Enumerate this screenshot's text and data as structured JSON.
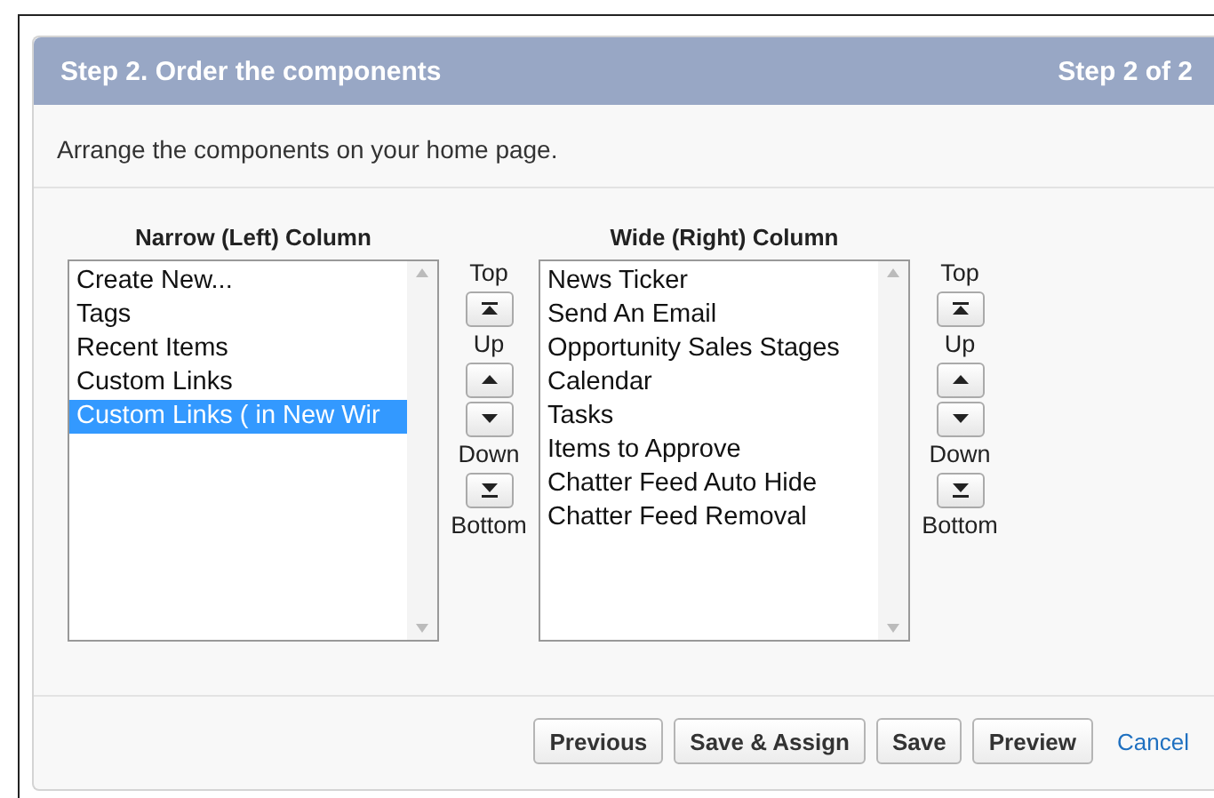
{
  "header": {
    "title": "Step 2. Order the components",
    "step": "Step 2 of 2"
  },
  "description": "Arrange the components on your home page.",
  "columns": [
    {
      "title": "Narrow (Left) Column",
      "items": [
        {
          "label": "Create New...",
          "selected": false
        },
        {
          "label": "Tags",
          "selected": false
        },
        {
          "label": "Recent Items",
          "selected": false
        },
        {
          "label": "Custom Links",
          "selected": false
        },
        {
          "label": "Custom Links ( in New Wir",
          "selected": true
        }
      ],
      "controls": [
        {
          "kind": "label",
          "text": "Top"
        },
        {
          "kind": "top"
        },
        {
          "kind": "label",
          "text": "Up"
        },
        {
          "kind": "up"
        },
        {
          "kind": "down"
        },
        {
          "kind": "label",
          "text": "Down"
        },
        {
          "kind": "bottom"
        },
        {
          "kind": "label",
          "text": "Bottom"
        }
      ]
    },
    {
      "title": "Wide (Right) Column",
      "items": [
        {
          "label": "News Ticker",
          "selected": false
        },
        {
          "label": "Send An Email",
          "selected": false
        },
        {
          "label": "Opportunity Sales Stages",
          "selected": false
        },
        {
          "label": "Calendar",
          "selected": false
        },
        {
          "label": "Tasks",
          "selected": false
        },
        {
          "label": "Items to Approve",
          "selected": false
        },
        {
          "label": "Chatter Feed Auto Hide",
          "selected": false
        },
        {
          "label": "Chatter Feed Removal",
          "selected": false
        }
      ],
      "controls": [
        {
          "kind": "label",
          "text": "Top"
        },
        {
          "kind": "top"
        },
        {
          "kind": "label",
          "text": "Up"
        },
        {
          "kind": "up"
        },
        {
          "kind": "down"
        },
        {
          "kind": "label",
          "text": "Down"
        },
        {
          "kind": "bottom"
        },
        {
          "kind": "label",
          "text": "Bottom"
        }
      ]
    }
  ],
  "footer": [
    {
      "kind": "button",
      "label": "Previous"
    },
    {
      "kind": "button",
      "label": "Save & Assign"
    },
    {
      "kind": "button",
      "label": "Save"
    },
    {
      "kind": "button",
      "label": "Preview"
    },
    {
      "kind": "link",
      "label": "Cancel"
    }
  ]
}
